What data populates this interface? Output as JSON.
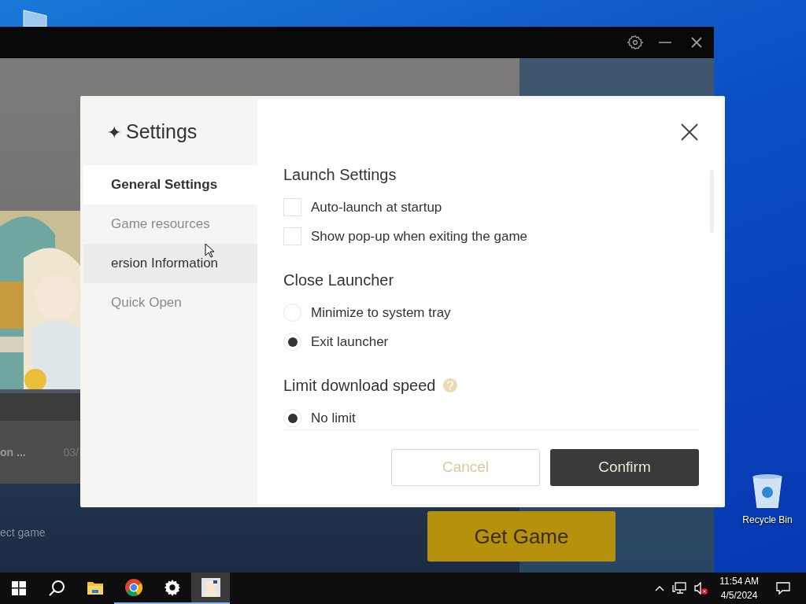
{
  "desktop": {
    "icons": [
      {
        "label": "Recycle Bin"
      }
    ]
  },
  "launcher": {
    "news_title": "on ...",
    "news_date": "03/",
    "link": "ect game",
    "primary_button": "Get Game"
  },
  "dialog": {
    "title_mark": "✦",
    "title": "Settings",
    "nav": [
      {
        "label": "General Settings",
        "selected": true,
        "hovered": false
      },
      {
        "label": "Game resources",
        "selected": false,
        "hovered": false
      },
      {
        "label": "ersion Information",
        "selected": false,
        "hovered": true
      },
      {
        "label": "Quick Open",
        "selected": false,
        "hovered": false
      }
    ],
    "sections": [
      {
        "heading": "Launch Settings",
        "help": false,
        "options": [
          {
            "kind": "checkbox",
            "label": "Auto-launch at startup",
            "checked": false
          },
          {
            "kind": "checkbox",
            "label": "Show pop-up when exiting the game",
            "checked": false
          }
        ]
      },
      {
        "heading": "Close Launcher",
        "help": false,
        "options": [
          {
            "kind": "radio",
            "label": "Minimize to system tray",
            "selected": false
          },
          {
            "kind": "radio",
            "label": "Exit launcher",
            "selected": true
          }
        ]
      },
      {
        "heading": "Limit download speed",
        "help": true,
        "options": [
          {
            "kind": "radio",
            "label": "No limit",
            "selected": true
          }
        ]
      }
    ],
    "buttons": [
      {
        "kind": "secondary",
        "label": "Cancel"
      },
      {
        "kind": "primary",
        "label": "Confirm"
      }
    ]
  },
  "taskbar": {
    "apps": [
      {
        "kind": "folder",
        "running": false,
        "active": false
      },
      {
        "kind": "browser",
        "running": true,
        "active": false
      },
      {
        "kind": "settings",
        "running": true,
        "active": false
      },
      {
        "kind": "game",
        "running": true,
        "active": true
      }
    ],
    "time": "11:54 AM",
    "date": "4/5/2024"
  }
}
